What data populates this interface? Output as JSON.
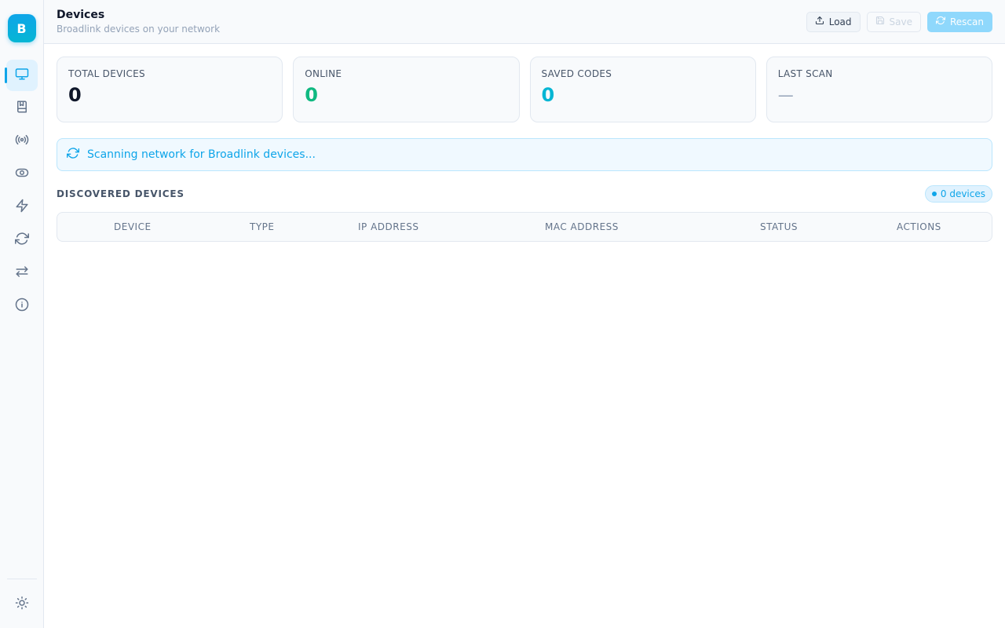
{
  "sidebar": {
    "logo_letter": "B",
    "items": [
      {
        "name": "devices",
        "icon": "monitor-icon",
        "active": true
      },
      {
        "name": "codes",
        "icon": "book-icon",
        "active": false
      },
      {
        "name": "broadcast",
        "icon": "broadcast-icon",
        "active": false
      },
      {
        "name": "toggle",
        "icon": "toggle-icon",
        "active": false
      },
      {
        "name": "automation",
        "icon": "bolt-icon",
        "active": false
      },
      {
        "name": "sync",
        "icon": "refresh-icon",
        "active": false
      },
      {
        "name": "transfer",
        "icon": "transfer-icon",
        "active": false
      },
      {
        "name": "about",
        "icon": "info-icon",
        "active": false
      }
    ],
    "theme_icon": "sun-icon"
  },
  "header": {
    "title": "Devices",
    "subtitle": "Broadlink devices on your network",
    "load_label": "Load",
    "save_label": "Save",
    "rescan_label": "Rescan"
  },
  "stats": {
    "total_label": "TOTAL DEVICES",
    "total_value": "0",
    "online_label": "ONLINE",
    "online_value": "0",
    "codes_label": "SAVED CODES",
    "codes_value": "0",
    "scan_label": "LAST SCAN",
    "scan_value": "—"
  },
  "scan_banner": {
    "text": "Scanning network for Broadlink devices..."
  },
  "devices_section": {
    "title": "DISCOVERED DEVICES",
    "count_label": "0 devices"
  },
  "table": {
    "columns": [
      "DEVICE",
      "TYPE",
      "IP ADDRESS",
      "MAC ADDRESS",
      "STATUS",
      "ACTIONS"
    ]
  },
  "colors": {
    "accent": "#0ea5e9",
    "online": "#10b981",
    "codes": "#06b6d4"
  }
}
